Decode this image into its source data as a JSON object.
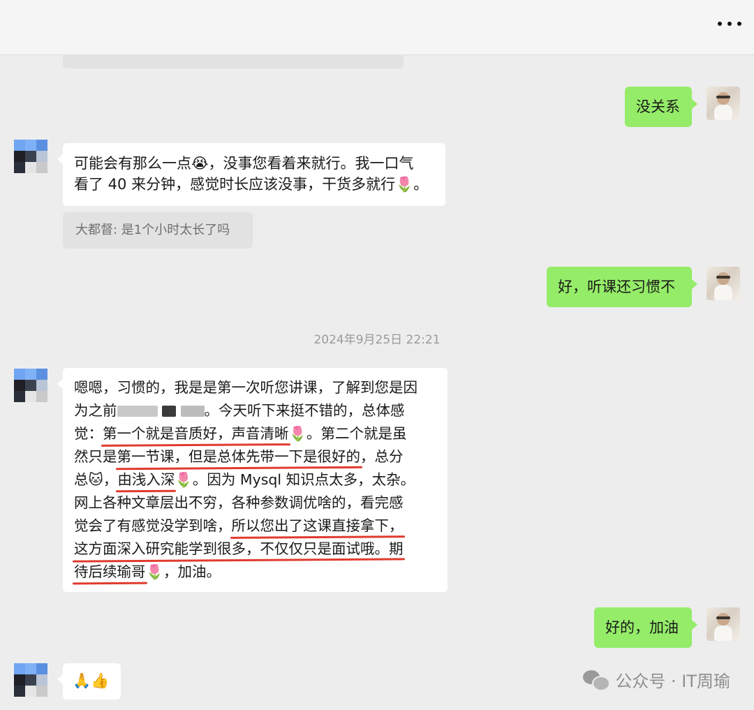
{
  "messages": {
    "out1": "没关系",
    "in1_lines": [
      "可能会有那么一点😭，没事您看着来就行。我一口气",
      "看了 40 来分钟，感觉时长应该没事，干货多就行🌷。"
    ],
    "quote": "大都督: 是1个小时太长了吗",
    "out2": "好，听课还习惯不",
    "timestamp": "2024年9月25日 22:21",
    "in2": {
      "l1": "嗯嗯，习惯的，我是是第一次听您讲课，了解到您是因",
      "l2a": "为之前",
      "l2b": "。今天听下来挺不错的，总体感",
      "l3a": "觉：",
      "l3u": "第一个就是音质好，声音清晰",
      "l3b": "🌷。第二个就是虽",
      "l4a": "然只是",
      "l4u": "第一节课，但是总体先带一下是很好的",
      "l4b": "，总分",
      "l5a": "总🐱，",
      "l5u": "由浅入深",
      "l5b": "🌷。因为 Mysql 知识点太多，太杂。",
      "l6": "网上各种文章层出不穷，各种参数调优啥的，看完感",
      "l7a": "觉会了有感觉没学到啥，",
      "l7u": "所以您出了这课直接拿下，",
      "l8u": "这方面深入研究能学到很多，不仅仅只是面试哦。期",
      "l9u": "待后续瑜哥",
      "l9b": "🌷，加油。"
    },
    "out3": "好的，加油",
    "in3": "🙏👍"
  },
  "watermark": "公众号 · IT周瑜"
}
